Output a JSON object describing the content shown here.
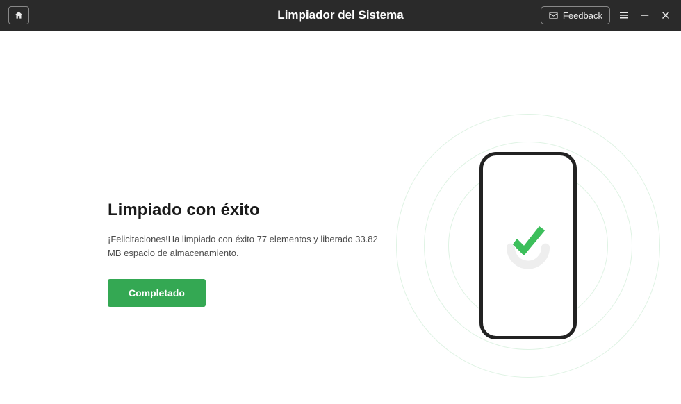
{
  "titlebar": {
    "title": "Limpiador del Sistema",
    "feedback_label": "Feedback"
  },
  "main": {
    "heading": "Limpiado con éxito",
    "subtext": "¡Felicitaciones!Ha limpiado con éxito 77 elementos y liberado 33.82 MB espacio de almacenamiento.",
    "button_label": "Completado"
  },
  "colors": {
    "accent": "#34a853",
    "titlebar_bg": "#2a2a2a"
  }
}
